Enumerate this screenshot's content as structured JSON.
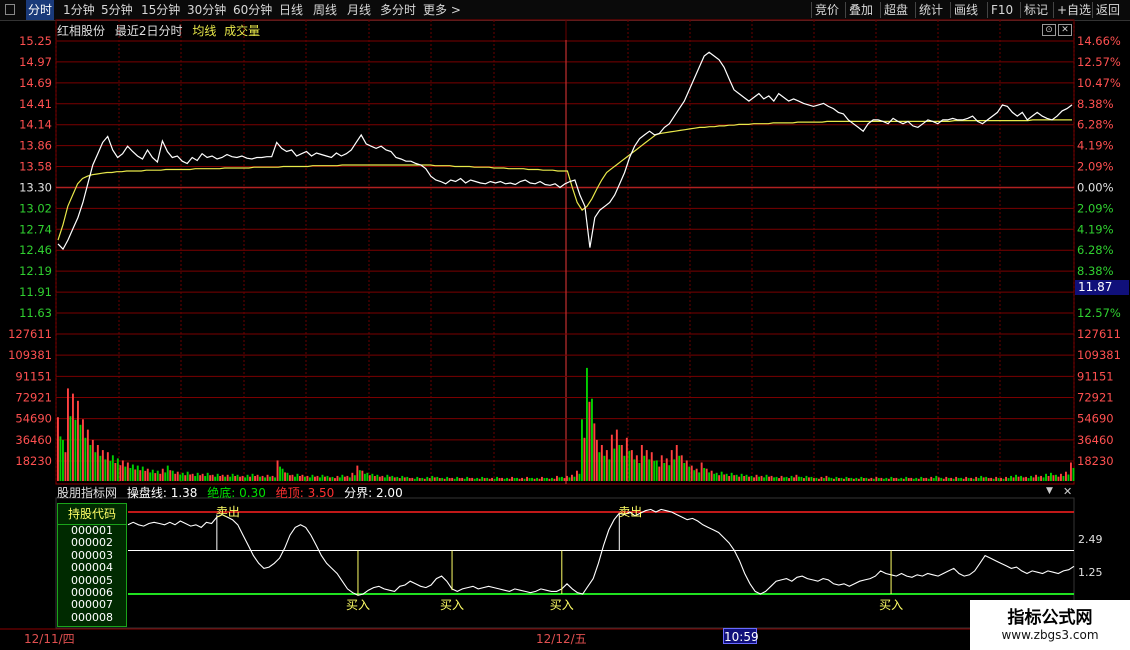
{
  "toolbar": {
    "left": [
      "分时",
      "1分钟",
      "5分钟",
      "15分钟",
      "30分钟",
      "60分钟",
      "日线",
      "周线",
      "月线",
      "多分时",
      "更多 >"
    ],
    "right": [
      "竞价",
      "叠加",
      "超盘",
      "统计",
      "画线",
      "F10",
      "标记",
      "+自选",
      "返回"
    ]
  },
  "info": {
    "stock": "红相股份",
    "mode": "最近2日分时",
    "avg_label": "均线",
    "vol_label": "成交量"
  },
  "indicator": {
    "name": "股朋指标网",
    "l1": "操盘线:",
    "v1": "1.38",
    "l2": "绝底:",
    "v2": "0.30",
    "l3": "绝顶:",
    "v3": "3.50",
    "l4": "分界:",
    "v4": "2.00",
    "sell": "卖出",
    "buy": "买入"
  },
  "holdings": {
    "title": "持股代码",
    "codes": [
      "000001",
      "000002",
      "000003",
      "000004",
      "000005",
      "000006",
      "000007",
      "000008"
    ]
  },
  "dates": {
    "d1": "12/11/四",
    "d2": "12/12/五",
    "cursor": "10:59"
  },
  "price_cursor": "11.87",
  "watermark": {
    "title": "指标公式网",
    "url": "www.zbgs3.com"
  },
  "colors": {
    "up": "#ff4040",
    "down": "#00d000",
    "avg": "#e8e84a",
    "price": "#ffffff",
    "grid": "#8b0000"
  },
  "chart_data": [
    {
      "type": "line",
      "title": "",
      "y_ticks_left": [
        "15.25",
        "14.97",
        "14.69",
        "14.41",
        "14.14",
        "13.86",
        "13.58",
        "13.30",
        "13.02",
        "12.74",
        "12.46",
        "12.19",
        "11.91",
        "11.63"
      ],
      "y_ticks_right": [
        "14.66%",
        "12.57%",
        "10.47%",
        "8.38%",
        "6.28%",
        "4.19%",
        "2.09%",
        "0.00%",
        "2.09%",
        "4.19%",
        "6.28%",
        "8.38%",
        "",
        "12.57%"
      ],
      "ylim": [
        11.63,
        15.25
      ],
      "prev_close": 13.3,
      "series": [
        {
          "name": "",
          "values": [
            12.55,
            12.48,
            12.6,
            12.75,
            12.9,
            13.1,
            13.35,
            13.6,
            13.75,
            13.9,
            13.98,
            13.8,
            13.7,
            13.75,
            13.85,
            13.78,
            13.72,
            13.68,
            13.8,
            13.7,
            13.64,
            13.92,
            13.78,
            13.7,
            13.72,
            13.65,
            13.62,
            13.7,
            13.66,
            13.75,
            13.7,
            13.72,
            13.68,
            13.7,
            13.74,
            13.71,
            13.7,
            13.72,
            13.69,
            13.68,
            13.7,
            13.7,
            13.71,
            13.71,
            13.9,
            13.82,
            13.78,
            13.8,
            13.72,
            13.75,
            13.78,
            13.72,
            13.76,
            13.74,
            13.72,
            13.7,
            13.76,
            13.72,
            13.75,
            13.8,
            13.9,
            14.0,
            13.88,
            13.85,
            13.82,
            13.85,
            13.8,
            13.78,
            13.7,
            13.68,
            13.65,
            13.65,
            13.62,
            13.6,
            13.55,
            13.45,
            13.4,
            13.38,
            13.35,
            13.4,
            13.38,
            13.42,
            13.36,
            13.4,
            13.38,
            13.36,
            13.35,
            13.38,
            13.36,
            13.38,
            13.35,
            13.36,
            13.34,
            13.38,
            13.4,
            13.36,
            13.35,
            13.38,
            13.34,
            13.33,
            13.35,
            13.3,
            13.35,
            13.38,
            13.4,
            13.2,
            13.05,
            12.5,
            12.9,
            13.0,
            13.05,
            13.1,
            13.2,
            13.35,
            13.5,
            13.7,
            13.85,
            13.95,
            14.0,
            14.05,
            14.0,
            14.02,
            14.1,
            14.15,
            14.25,
            14.35,
            14.45,
            14.6,
            14.75,
            14.9,
            15.05,
            15.1,
            15.05,
            15.0,
            14.9,
            14.75,
            14.6,
            14.55,
            14.5,
            14.45,
            14.5,
            14.55,
            14.48,
            14.52,
            14.45,
            14.55,
            14.5,
            14.45,
            14.48,
            14.45,
            14.42,
            14.4,
            14.38,
            14.4,
            14.42,
            14.38,
            14.35,
            14.3,
            14.28,
            14.2,
            14.15,
            14.1,
            14.05,
            14.15,
            14.2,
            14.2,
            14.18,
            14.15,
            14.22,
            14.18,
            14.15,
            14.18,
            14.12,
            14.1,
            14.15,
            14.2,
            14.18,
            14.15,
            14.2,
            14.2,
            14.22,
            14.2,
            14.2,
            14.22,
            14.25,
            14.18,
            14.15,
            14.2,
            14.25,
            14.3,
            14.4,
            14.38,
            14.3,
            14.25,
            14.3,
            14.2,
            14.25,
            14.3,
            14.25,
            14.22,
            14.2,
            14.25,
            14.32,
            14.35,
            14.4
          ]
        },
        {
          "name": "",
          "values": [
            12.6,
            12.8,
            13.05,
            13.2,
            13.35,
            13.42,
            13.45,
            13.47,
            13.48,
            13.49,
            13.5,
            13.5,
            13.51,
            13.51,
            13.52,
            13.52,
            13.52,
            13.52,
            13.53,
            13.53,
            13.53,
            13.53,
            13.54,
            13.54,
            13.54,
            13.54,
            13.54,
            13.54,
            13.55,
            13.55,
            13.55,
            13.55,
            13.55,
            13.55,
            13.56,
            13.56,
            13.56,
            13.56,
            13.56,
            13.56,
            13.57,
            13.57,
            13.57,
            13.57,
            13.57,
            13.57,
            13.58,
            13.58,
            13.58,
            13.58,
            13.58,
            13.58,
            13.59,
            13.59,
            13.59,
            13.59,
            13.59,
            13.59,
            13.6,
            13.6,
            13.6,
            13.6,
            13.6,
            13.6,
            13.6,
            13.6,
            13.6,
            13.6,
            13.6,
            13.6,
            13.6,
            13.6,
            13.6,
            13.6,
            13.6,
            13.6,
            13.6,
            13.59,
            13.59,
            13.59,
            13.59,
            13.58,
            13.58,
            13.58,
            13.58,
            13.57,
            13.57,
            13.57,
            13.57,
            13.56,
            13.56,
            13.56,
            13.55,
            13.55,
            13.55,
            13.55,
            13.54,
            13.54,
            13.54,
            13.53,
            13.53,
            13.53,
            13.52,
            13.52,
            13.52,
            13.3,
            13.1,
            13.0,
            13.05,
            13.15,
            13.28,
            13.4,
            13.5,
            13.55,
            13.6,
            13.65,
            13.7,
            13.75,
            13.8,
            13.85,
            13.9,
            13.95,
            14.0,
            14.02,
            14.03,
            14.04,
            14.05,
            14.06,
            14.07,
            14.08,
            14.09,
            14.1,
            14.1,
            14.11,
            14.11,
            14.12,
            14.12,
            14.13,
            14.13,
            14.14,
            14.14,
            14.14,
            14.15,
            14.15,
            14.15,
            14.15,
            14.16,
            14.16,
            14.16,
            14.16,
            14.16,
            14.17,
            14.17,
            14.17,
            14.17,
            14.17,
            14.17,
            14.18,
            14.18,
            14.18,
            14.18,
            14.18,
            14.18,
            14.18,
            14.18,
            14.18,
            14.18,
            14.18,
            14.18,
            14.18,
            14.18,
            14.18,
            14.18,
            14.18,
            14.18,
            14.18,
            14.18,
            14.18,
            14.18,
            14.18,
            14.18,
            14.18,
            14.18,
            14.19,
            14.19,
            14.19,
            14.19,
            14.19,
            14.19,
            14.19,
            14.19,
            14.19,
            14.19,
            14.19,
            14.19,
            14.19,
            14.19,
            14.19,
            14.19,
            14.2,
            14.2,
            14.2,
            14.2,
            14.2,
            14.2,
            14.2,
            14.2,
            14.2
          ]
        }
      ]
    },
    {
      "type": "bar",
      "title": "",
      "y_ticks": [
        "127611",
        "109381",
        "91151",
        "72921",
        "54690",
        "36460",
        "18230"
      ],
      "ylim": [
        0,
        127611
      ],
      "values": [
        62000,
        40000,
        90000,
        85000,
        78000,
        60000,
        50000,
        40000,
        35000,
        30000,
        28000,
        25000,
        22000,
        20000,
        18000,
        16000,
        15000,
        14000,
        12000,
        11000,
        10000,
        12000,
        15000,
        10000,
        9000,
        8000,
        9000,
        7000,
        8000,
        7000,
        8000,
        6000,
        7000,
        6000,
        6000,
        7000,
        6000,
        5000,
        6000,
        7000,
        6000,
        5000,
        6000,
        5000,
        20000,
        12000,
        8000,
        6000,
        7000,
        6000,
        5000,
        6000,
        5000,
        6000,
        5000,
        4000,
        5000,
        6000,
        5000,
        8000,
        15000,
        10000,
        8000,
        7000,
        6000,
        5000,
        6000,
        5000,
        4000,
        5000,
        4000,
        3000,
        4000,
        3000,
        4000,
        5000,
        4000,
        3000,
        4000,
        3000,
        4000,
        3000,
        4000,
        3000,
        3000,
        4000,
        3000,
        3000,
        4000,
        3000,
        3000,
        4000,
        3000,
        3000,
        4000,
        3000,
        3000,
        4000,
        3000,
        3000,
        5000,
        4000,
        5000,
        6000,
        10000,
        60000,
        110000,
        80000,
        40000,
        35000,
        30000,
        45000,
        50000,
        35000,
        42000,
        30000,
        25000,
        35000,
        30000,
        28000,
        20000,
        25000,
        22000,
        30000,
        35000,
        25000,
        20000,
        15000,
        12000,
        18000,
        12000,
        10000,
        8000,
        9000,
        7000,
        8000,
        6000,
        7000,
        6000,
        5000,
        6000,
        5000,
        6000,
        5000,
        4000,
        5000,
        4000,
        5000,
        6000,
        4000,
        5000,
        4000,
        3000,
        4000,
        5000,
        3000,
        4000,
        3000,
        4000,
        3000,
        3000,
        4000,
        3000,
        3000,
        4000,
        3000,
        3000,
        4000,
        3000,
        3000,
        4000,
        3000,
        3000,
        4000,
        3000,
        4000,
        5000,
        3000,
        4000,
        3000,
        4000,
        3000,
        4000,
        3000,
        4000,
        5000,
        4000,
        3000,
        4000,
        3000,
        4000,
        5000,
        6000,
        5000,
        4000,
        5000,
        6000,
        5000,
        7000,
        8000,
        6000,
        7000,
        9000,
        18000
      ]
    },
    {
      "type": "line",
      "title": "",
      "y_ticks": [
        "2.49",
        "1.25"
      ],
      "ylim": [
        0,
        4.0
      ],
      "levels": {
        "top": 3.5,
        "mid": 2.0,
        "bottom": 0.3
      },
      "series": [
        {
          "name": "",
          "values": [
            3.0,
            3.1,
            3.0,
            2.95,
            3.05,
            3.1,
            3.05,
            3.0,
            3.1,
            3.0,
            3.15,
            3.05,
            2.95,
            3.0,
            2.9,
            3.1,
            3.05,
            3.3,
            3.4,
            3.3,
            3.2,
            3.0,
            2.6,
            2.2,
            1.8,
            1.5,
            1.3,
            1.35,
            1.5,
            1.7,
            2.1,
            2.6,
            2.9,
            3.0,
            2.9,
            2.6,
            2.2,
            1.8,
            1.5,
            1.3,
            1.1,
            0.8,
            0.5,
            0.35,
            0.25,
            0.3,
            0.45,
            0.55,
            0.6,
            0.5,
            0.45,
            0.4,
            0.6,
            0.65,
            0.8,
            0.7,
            0.6,
            0.55,
            0.65,
            0.9,
            1.0,
            0.8,
            0.5,
            0.4,
            0.5,
            0.55,
            0.6,
            0.5,
            0.55,
            0.6,
            0.55,
            0.5,
            0.45,
            0.4,
            0.5,
            0.45,
            0.4,
            0.35,
            0.4,
            0.5,
            0.45,
            0.4,
            0.4,
            0.5,
            0.7,
            0.5,
            0.35,
            0.3,
            0.6,
            0.9,
            1.5,
            2.2,
            2.8,
            3.2,
            3.45,
            3.4,
            3.5,
            3.35,
            3.45,
            3.55,
            3.6,
            3.5,
            3.6,
            3.55,
            3.5,
            3.4,
            3.3,
            3.2,
            3.25,
            3.15,
            3.0,
            2.9,
            2.8,
            2.7,
            2.5,
            2.3,
            2.0,
            1.6,
            1.1,
            0.7,
            0.4,
            0.3,
            0.4,
            0.6,
            0.8,
            0.85,
            0.9,
            0.8,
            0.95,
            1.0,
            0.9,
            0.85,
            0.8,
            0.9,
            0.85,
            0.7,
            0.65,
            0.7,
            0.6,
            0.7,
            0.8,
            0.85,
            0.9,
            1.0,
            1.2,
            1.1,
            1.05,
            1.0,
            1.1,
            1.0,
            0.95,
            1.05,
            1.0,
            1.1,
            1.05,
            1.0,
            1.1,
            1.2,
            1.3,
            1.1,
            1.0,
            1.05,
            1.2,
            1.5,
            1.8,
            1.7,
            1.6,
            1.5,
            1.4,
            1.3,
            1.35,
            1.2,
            1.1,
            1.2,
            1.15,
            1.1,
            1.2,
            1.15,
            1.1,
            1.2,
            1.25,
            1.38
          ]
        }
      ],
      "signals": [
        {
          "label": "sell",
          "index": 17,
          "value": 3.4
        },
        {
          "label": "buy",
          "index": 44,
          "value": 0.25
        },
        {
          "label": "buy",
          "index": 62,
          "value": 0.45
        },
        {
          "label": "buy",
          "index": 83,
          "value": 0.3
        },
        {
          "label": "sell",
          "index": 94,
          "value": 3.45
        },
        {
          "label": "buy",
          "index": 146,
          "value": 0.3
        }
      ]
    }
  ]
}
